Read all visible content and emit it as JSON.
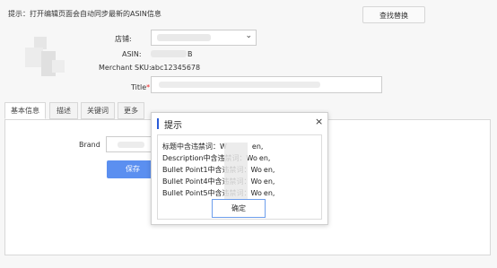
{
  "topbar": {
    "tip": "提示：打开编辑页面会自动同步最新的ASIN信息",
    "find_replace_label": "查找替换"
  },
  "form": {
    "store_label": "店铺:",
    "asin_label": "ASIN:",
    "asin_suffix": "B",
    "sku_label": "Merchant SKU:",
    "sku_value": "abc12345678",
    "title_label": "Title",
    "title_required_mark": "*"
  },
  "tabs": [
    {
      "label": "基本信息",
      "active": true
    },
    {
      "label": "描述",
      "active": false
    },
    {
      "label": "关键词",
      "active": false
    },
    {
      "label": "更多",
      "active": false
    }
  ],
  "panel": {
    "brand_label": "Brand",
    "save_label": "保存"
  },
  "modal": {
    "title": "提示",
    "close_glyph": "×",
    "messages": [
      "标题中含违禁词：W",
      "Description中含违禁词：Wo",
      "Bullet Point1中含违禁词：Wo",
      "Bullet Point4中含违禁词：Wo",
      "Bullet Point5中含违禁词：Wo"
    ],
    "message_tails": [
      "en,",
      "en,",
      "en,",
      "en,",
      "en,"
    ],
    "ok_label": "确定"
  },
  "colors": {
    "primary": "#5b8ff0",
    "modal_accent": "#2a5bd7",
    "required": "#e22"
  }
}
